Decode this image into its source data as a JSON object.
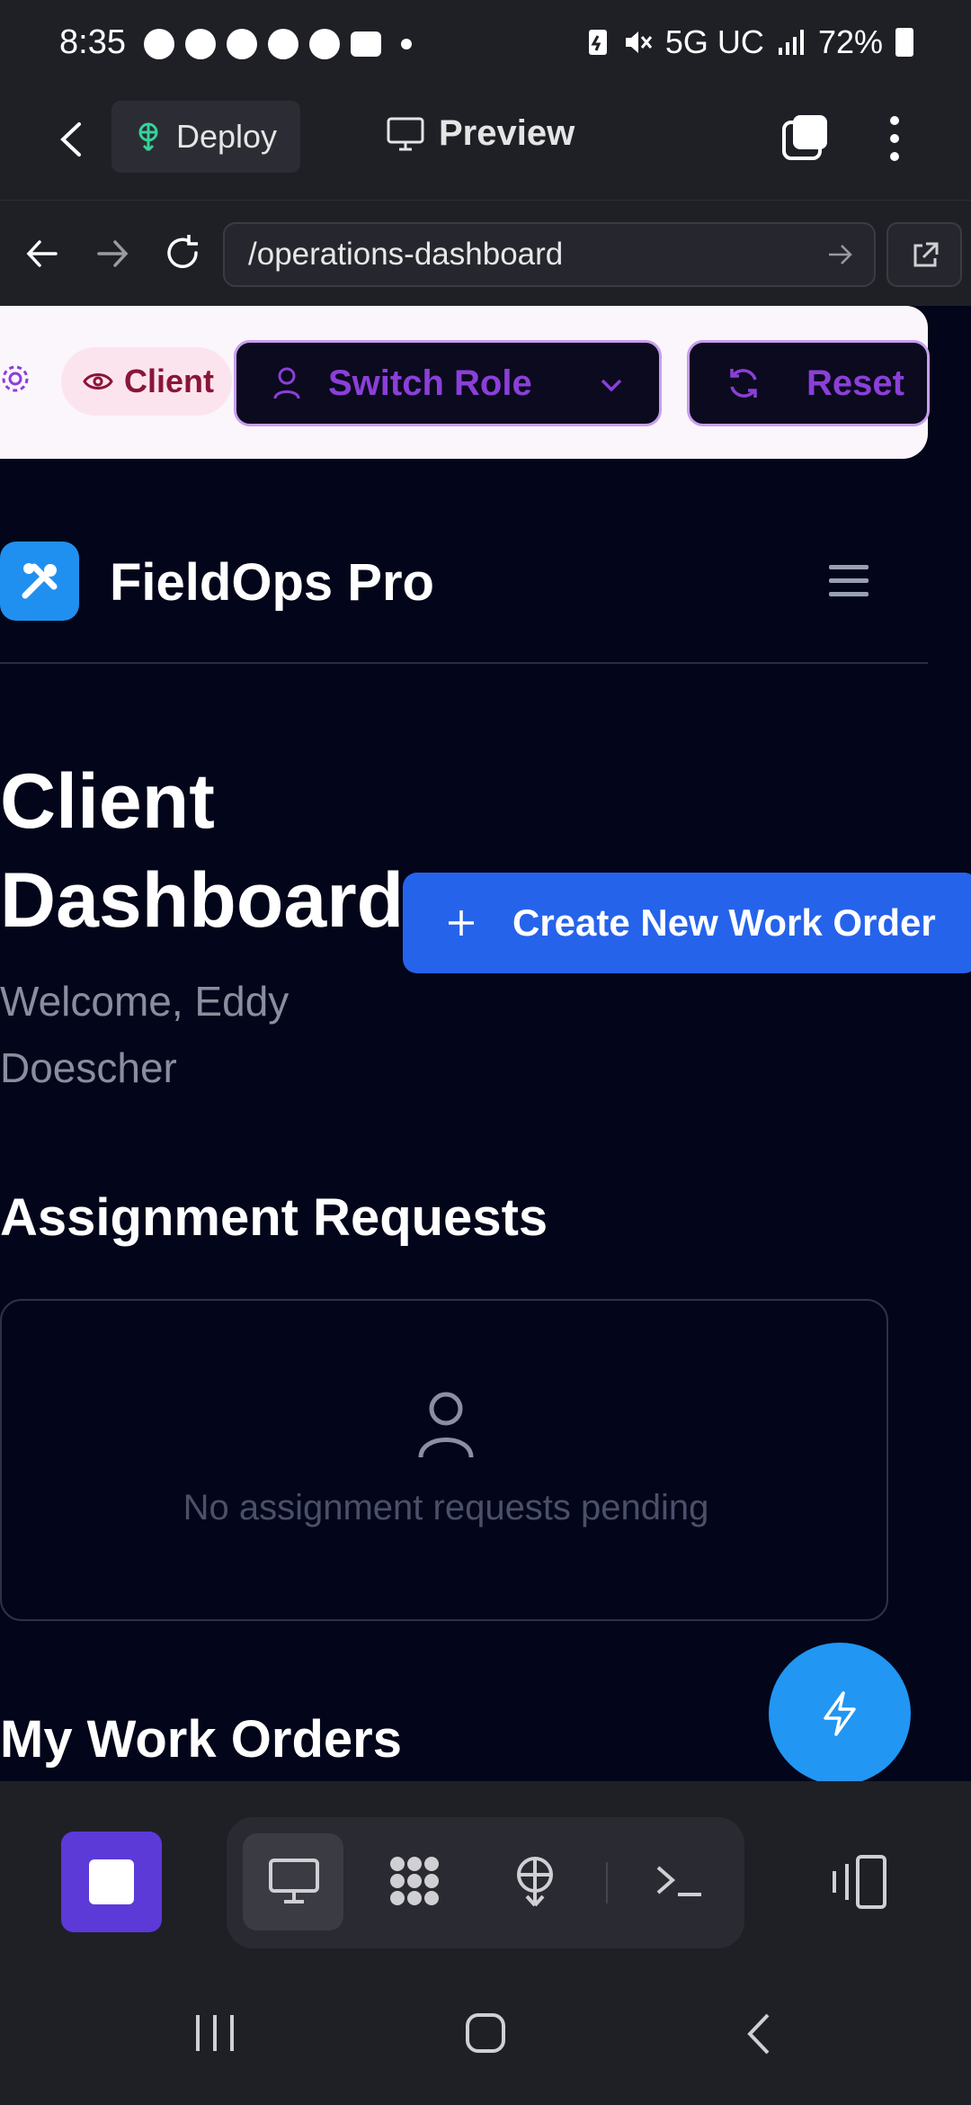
{
  "status_bar": {
    "time": "8:35",
    "network": "5G UC",
    "battery": "72%"
  },
  "top_nav": {
    "deploy_label": "Deploy",
    "preview_label": "Preview"
  },
  "url_bar": {
    "url": "/operations-dashboard"
  },
  "role_bar": {
    "role_badge": "Client",
    "switch_role_label": "Switch Role",
    "reset_label": "Reset"
  },
  "app": {
    "title": "FieldOps Pro",
    "page_title": "Client Dashboard",
    "welcome": "Welcome, Eddy Doescher",
    "create_label": "Create New Work Order"
  },
  "assignments": {
    "title": "Assignment Requests",
    "empty_text": "No assignment requests pending"
  },
  "work_orders": {
    "title": "My Work Orders"
  },
  "colors": {
    "accent_blue": "#2563eb",
    "role_purple": "#8b3fd9",
    "client_badge": "#8a1538",
    "page_bg": "#03061a"
  }
}
